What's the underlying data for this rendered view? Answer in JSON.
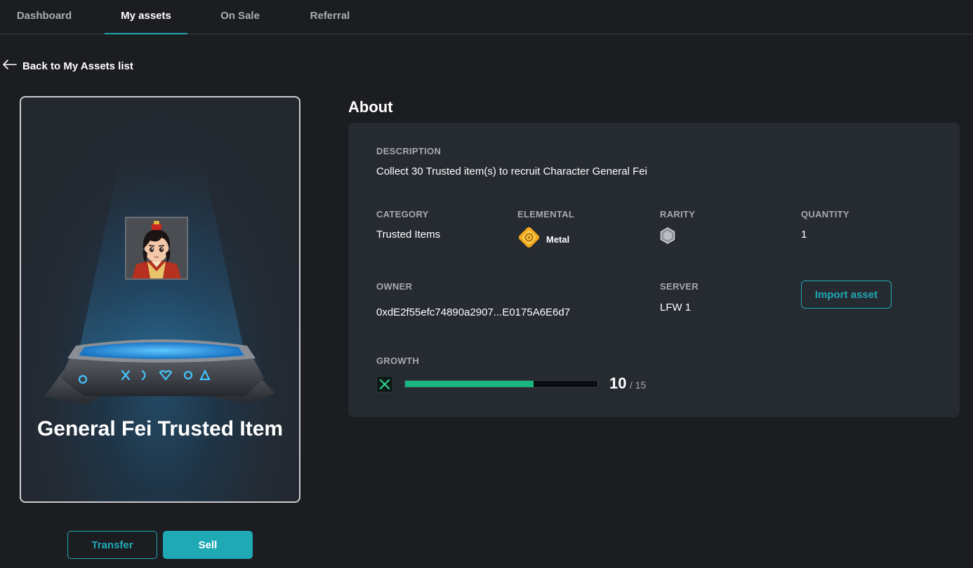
{
  "nav": {
    "tabs": [
      {
        "label": "Dashboard",
        "active": false
      },
      {
        "label": "My assets",
        "active": true
      },
      {
        "label": "On Sale",
        "active": false
      },
      {
        "label": "Referral",
        "active": false
      }
    ]
  },
  "back_link": {
    "label": "Back to My Assets list",
    "icon": "arrow-left-icon"
  },
  "card": {
    "title": "General Fei Trusted Item",
    "portrait_icon": "general-fei-portrait"
  },
  "actions": {
    "transfer_label": "Transfer",
    "sell_label": "Sell"
  },
  "about": {
    "heading": "About",
    "description_label": "DESCRIPTION",
    "description": "Collect 30 Trusted item(s) to recruit Character General Fei",
    "category_label": "CATEGORY",
    "category": "Trusted Items",
    "elemental_label": "ELEMENTAL",
    "elemental": "Metal",
    "elemental_icon": "metal-element-icon",
    "rarity_label": "RARITY",
    "rarity_icon": "gray-hexagon-rarity-icon",
    "quantity_label": "QUANTITY",
    "quantity": "1",
    "owner_label": "OWNER",
    "owner": "0xdE2f55efc74890a2907...E0175A6E6d7",
    "server_label": "SERVER",
    "server": "LFW 1",
    "import_label": "Import asset",
    "growth_label": "GROWTH",
    "growth_current": "10",
    "growth_max": "/ 15",
    "growth_fraction": 0.667
  },
  "colors": {
    "accent": "#1fa9b5",
    "growth_bar": "#18b784",
    "background": "#1b1d21",
    "panel": "#262a31"
  }
}
